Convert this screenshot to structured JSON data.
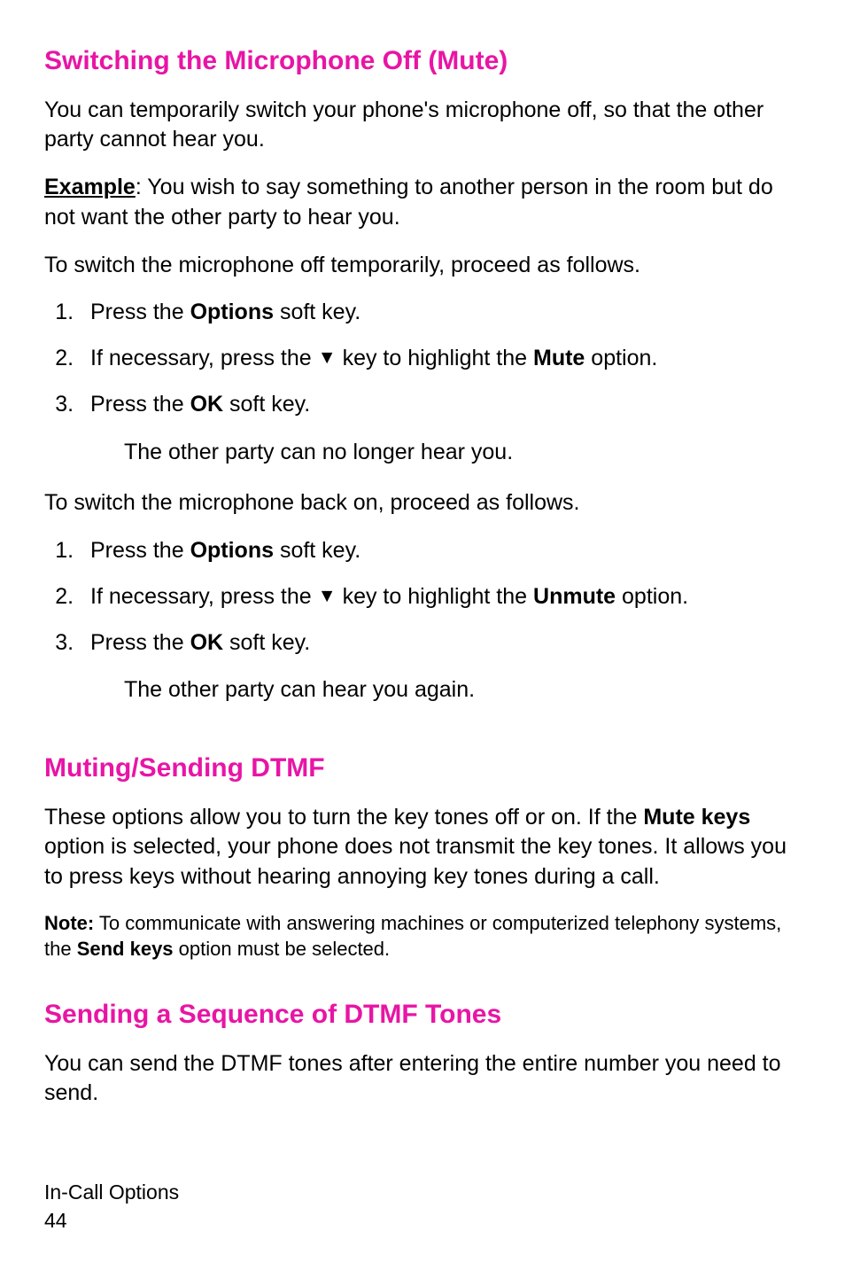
{
  "colors": {
    "accent": "#e815a5"
  },
  "s1": {
    "heading": "Switching the Microphone Off (Mute)",
    "intro": "You can temporarily switch your phone's microphone off, so that the other party cannot hear you.",
    "example_label": "Example",
    "example_text": ": You wish to say something to another person in the room but do not want the other party to hear you.",
    "lead_off": "To switch the microphone off temporarily, proceed as follows.",
    "off_steps": {
      "s1_a": "Press the ",
      "s1_b": "Options",
      "s1_c": " soft key.",
      "s2_a": "If necessary, press the ",
      "s2_key": "▼",
      "s2_b": " key to highlight the ",
      "s2_c": "Mute",
      "s2_d": " option.",
      "s3_a": "Press the ",
      "s3_b": "OK",
      "s3_c": " soft key."
    },
    "off_result": "The other party can no longer hear you.",
    "lead_on": "To switch the microphone back on, proceed as follows.",
    "on_steps": {
      "s1_a": "Press the ",
      "s1_b": "Options",
      "s1_c": " soft key.",
      "s2_a": "If necessary, press the ",
      "s2_key": "▼",
      "s2_b": " key to highlight the ",
      "s2_c": "Unmute",
      "s2_d": " option.",
      "s3_a": "Press the ",
      "s3_b": "OK",
      "s3_c": " soft key."
    },
    "on_result": "The other party can hear you again."
  },
  "s2": {
    "heading": "Muting/Sending DTMF",
    "p_a": "These options allow you to turn the key tones off or on. If the ",
    "p_b": "Mute keys",
    "p_c": " option is selected, your phone does not transmit the key tones. It allows you to press keys without hearing annoying key tones during a call.",
    "note_a": "Note:",
    "note_b": " To communicate with answering machines or computerized telephony systems, the ",
    "note_c": "Send keys",
    "note_d": " option must be selected."
  },
  "s3": {
    "heading": "Sending a Sequence of DTMF Tones",
    "p": "You can send the DTMF tones after entering the entire number you need to send."
  },
  "footer": {
    "chapter": "In-Call Options",
    "page": "44"
  }
}
